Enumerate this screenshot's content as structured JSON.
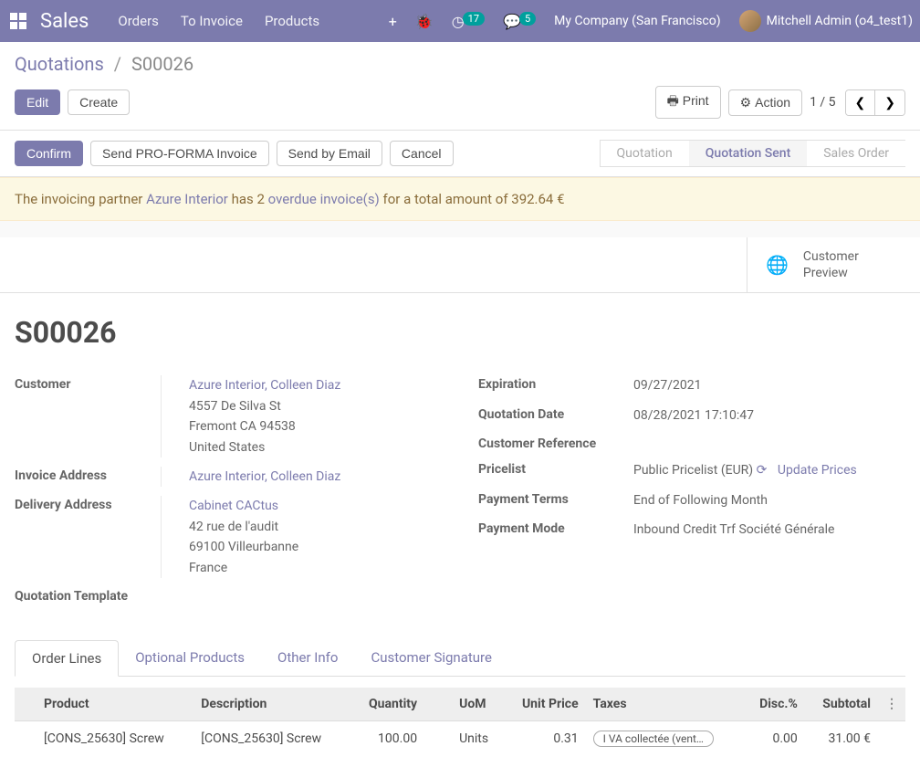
{
  "navbar": {
    "brand": "Sales",
    "links": [
      "Orders",
      "To Invoice",
      "Products"
    ],
    "messaging_badge": "17",
    "discuss_badge": "5",
    "company": "My Company (San Francisco)",
    "user": "Mitchell Admin (o4_test1)"
  },
  "breadcrumb": {
    "root": "Quotations",
    "current": "S00026"
  },
  "cp": {
    "edit": "Edit",
    "create": "Create",
    "print": "Print",
    "action": "Action",
    "pager": "1 / 5"
  },
  "status_buttons": {
    "confirm": "Confirm",
    "proforma": "Send PRO-FORMA Invoice",
    "send_email": "Send by Email",
    "cancel": "Cancel"
  },
  "status_steps": {
    "quotation": "Quotation",
    "quotation_sent": "Quotation Sent",
    "sales_order": "Sales Order"
  },
  "warning": {
    "prefix": "The invoicing partner ",
    "partner": "Azure Interior",
    "has": " has 2 ",
    "overdue_link": "overdue invoice(s)",
    "suffix": " for a total amount of 392.64 €"
  },
  "stat_button": {
    "line1": "Customer",
    "line2": "Preview"
  },
  "record": {
    "name": "S00026",
    "customer_label": "Customer",
    "customer_link": "Azure Interior, Colleen Diaz",
    "customer_street": "4557 De Silva St",
    "customer_city": "Fremont CA 94538",
    "customer_country": "United States",
    "invoice_label": "Invoice Address",
    "invoice_link": "Azure Interior, Colleen Diaz",
    "delivery_label": "Delivery Address",
    "delivery_link": "Cabinet CACtus",
    "delivery_street": "42 rue de l'audit",
    "delivery_city": "69100 Villeurbanne",
    "delivery_country": "France",
    "template_label": "Quotation Template",
    "expiration_label": "Expiration",
    "expiration": "09/27/2021",
    "quotation_date_label": "Quotation Date",
    "quotation_date": "08/28/2021 17:10:47",
    "customer_ref_label": "Customer Reference",
    "pricelist_label": "Pricelist",
    "pricelist": "Public Pricelist (EUR)",
    "update_prices": "Update Prices",
    "payment_terms_label": "Payment Terms",
    "payment_terms": "End of Following Month",
    "payment_mode_label": "Payment Mode",
    "payment_mode": "Inbound Credit Trf Société Générale"
  },
  "tabs": {
    "order_lines": "Order Lines",
    "optional": "Optional Products",
    "other": "Other Info",
    "signature": "Customer Signature"
  },
  "table": {
    "headers": {
      "product": "Product",
      "description": "Description",
      "quantity": "Quantity",
      "uom": "UoM",
      "unit_price": "Unit Price",
      "taxes": "Taxes",
      "discount": "Disc.%",
      "subtotal": "Subtotal"
    },
    "rows": [
      {
        "product": "[CONS_25630] Screw",
        "description": "[CONS_25630] Screw",
        "quantity": "100.00",
        "uom": "Units",
        "unit_price": "0.31",
        "tax": "I VA collectée (vent…",
        "discount": "0.00",
        "subtotal": "31.00 €"
      }
    ]
  }
}
